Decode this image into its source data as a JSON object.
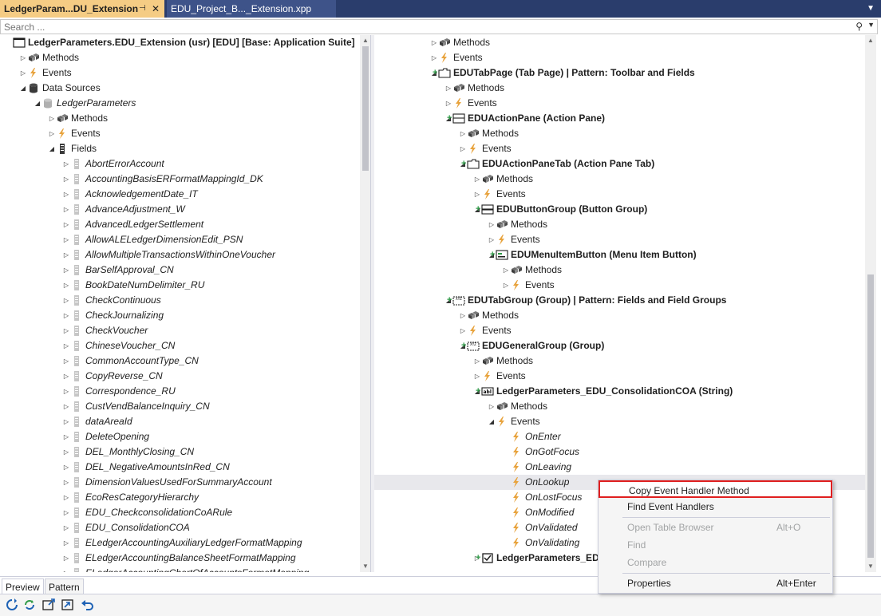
{
  "tabs": [
    {
      "label": "LedgerParam...DU_Extension",
      "pin": "⊣",
      "close": "✕"
    },
    {
      "label": "EDU_Project_B..._Extension.xpp"
    }
  ],
  "search": {
    "placeholder": "Search ..."
  },
  "left_tree": [
    {
      "label": "LedgerParameters.EDU_Extension (usr) [EDU] [Base: Application Suite]",
      "icon": "form-icon",
      "depth": 0,
      "expander": "none",
      "bold": true
    },
    {
      "label": "Methods",
      "icon": "methods-icon",
      "depth": 1,
      "expander": "closed"
    },
    {
      "label": "Events",
      "icon": "events-icon",
      "depth": 1,
      "expander": "closed"
    },
    {
      "label": "Data Sources",
      "icon": "datasources-icon",
      "depth": 1,
      "expander": "open"
    },
    {
      "label": "LedgerParameters",
      "icon": "datasource-icon",
      "depth": 2,
      "expander": "open",
      "italic": true
    },
    {
      "label": "Methods",
      "icon": "methods-icon",
      "depth": 3,
      "expander": "closed"
    },
    {
      "label": "Events",
      "icon": "events-icon",
      "depth": 3,
      "expander": "closed"
    },
    {
      "label": "Fields",
      "icon": "fields-icon",
      "depth": 3,
      "expander": "open"
    },
    {
      "label": "AbortErrorAccount",
      "icon": "field-icon",
      "depth": 4,
      "expander": "closed",
      "italic": true
    },
    {
      "label": "AccountingBasisERFormatMappingId_DK",
      "icon": "field-icon",
      "depth": 4,
      "expander": "closed",
      "italic": true
    },
    {
      "label": "AcknowledgementDate_IT",
      "icon": "field-icon",
      "depth": 4,
      "expander": "closed",
      "italic": true
    },
    {
      "label": "AdvanceAdjustment_W",
      "icon": "field-icon",
      "depth": 4,
      "expander": "closed",
      "italic": true
    },
    {
      "label": "AdvancedLedgerSettlement",
      "icon": "field-icon",
      "depth": 4,
      "expander": "closed",
      "italic": true
    },
    {
      "label": "AllowALELedgerDimensionEdit_PSN",
      "icon": "field-icon",
      "depth": 4,
      "expander": "closed",
      "italic": true
    },
    {
      "label": "AllowMultipleTransactionsWithinOneVoucher",
      "icon": "field-icon",
      "depth": 4,
      "expander": "closed",
      "italic": true
    },
    {
      "label": "BarSelfApproval_CN",
      "icon": "field-icon",
      "depth": 4,
      "expander": "closed",
      "italic": true
    },
    {
      "label": "BookDateNumDelimiter_RU",
      "icon": "field-icon",
      "depth": 4,
      "expander": "closed",
      "italic": true
    },
    {
      "label": "CheckContinuous",
      "icon": "field-icon",
      "depth": 4,
      "expander": "closed",
      "italic": true
    },
    {
      "label": "CheckJournalizing",
      "icon": "field-icon",
      "depth": 4,
      "expander": "closed",
      "italic": true
    },
    {
      "label": "CheckVoucher",
      "icon": "field-icon",
      "depth": 4,
      "expander": "closed",
      "italic": true
    },
    {
      "label": "ChineseVoucher_CN",
      "icon": "field-icon",
      "depth": 4,
      "expander": "closed",
      "italic": true
    },
    {
      "label": "CommonAccountType_CN",
      "icon": "field-icon",
      "depth": 4,
      "expander": "closed",
      "italic": true
    },
    {
      "label": "CopyReverse_CN",
      "icon": "field-icon",
      "depth": 4,
      "expander": "closed",
      "italic": true
    },
    {
      "label": "Correspondence_RU",
      "icon": "field-icon",
      "depth": 4,
      "expander": "closed",
      "italic": true
    },
    {
      "label": "CustVendBalanceInquiry_CN",
      "icon": "field-icon",
      "depth": 4,
      "expander": "closed",
      "italic": true
    },
    {
      "label": "dataAreaId",
      "icon": "field-icon",
      "depth": 4,
      "expander": "closed",
      "italic": true
    },
    {
      "label": "DeleteOpening",
      "icon": "field-icon",
      "depth": 4,
      "expander": "closed",
      "italic": true
    },
    {
      "label": "DEL_MonthlyClosing_CN",
      "icon": "field-icon",
      "depth": 4,
      "expander": "closed",
      "italic": true
    },
    {
      "label": "DEL_NegativeAmountsInRed_CN",
      "icon": "field-icon",
      "depth": 4,
      "expander": "closed",
      "italic": true
    },
    {
      "label": "DimensionValuesUsedForSummaryAccount",
      "icon": "field-icon",
      "depth": 4,
      "expander": "closed",
      "italic": true
    },
    {
      "label": "EcoResCategoryHierarchy",
      "icon": "field-icon",
      "depth": 4,
      "expander": "closed",
      "italic": true
    },
    {
      "label": "EDU_CheckconsolidationCoARule",
      "icon": "field-icon",
      "depth": 4,
      "expander": "closed",
      "italic": true
    },
    {
      "label": "EDU_ConsolidationCOA",
      "icon": "field-icon",
      "depth": 4,
      "expander": "closed",
      "italic": true
    },
    {
      "label": "ELedgerAccountingAuxiliaryLedgerFormatMapping",
      "icon": "field-icon",
      "depth": 4,
      "expander": "closed",
      "italic": true
    },
    {
      "label": "ELedgerAccountingBalanceSheetFormatMapping",
      "icon": "field-icon",
      "depth": 4,
      "expander": "closed",
      "italic": true
    },
    {
      "label": "ELedgerAccountingChartOfAccountsFormatMapping",
      "icon": "field-icon",
      "depth": 4,
      "expander": "closed",
      "italic": true
    }
  ],
  "right_tree": [
    {
      "label": "Methods",
      "icon": "methods-icon",
      "depth": 3,
      "expander": "closed"
    },
    {
      "label": "Events",
      "icon": "events-icon",
      "depth": 3,
      "expander": "closed"
    },
    {
      "label": "EDUTabPage (Tab Page) | Pattern: Toolbar and Fields",
      "icon": "tabpage-icon",
      "depth": 3,
      "expander": "open",
      "plus": true,
      "bold": true
    },
    {
      "label": "Methods",
      "icon": "methods-icon",
      "depth": 4,
      "expander": "closed"
    },
    {
      "label": "Events",
      "icon": "events-icon",
      "depth": 4,
      "expander": "closed"
    },
    {
      "label": "EDUActionPane (Action Pane)",
      "icon": "actionpane-icon",
      "depth": 4,
      "expander": "open",
      "plus": true,
      "bold": true
    },
    {
      "label": "Methods",
      "icon": "methods-icon",
      "depth": 5,
      "expander": "closed"
    },
    {
      "label": "Events",
      "icon": "events-icon",
      "depth": 5,
      "expander": "closed"
    },
    {
      "label": "EDUActionPaneTab (Action Pane Tab)",
      "icon": "tabpage-icon",
      "depth": 5,
      "expander": "open",
      "plus": true,
      "bold": true
    },
    {
      "label": "Methods",
      "icon": "methods-icon",
      "depth": 6,
      "expander": "closed"
    },
    {
      "label": "Events",
      "icon": "events-icon",
      "depth": 6,
      "expander": "closed"
    },
    {
      "label": "EDUButtonGroup (Button Group)",
      "icon": "buttongroup-icon",
      "depth": 6,
      "expander": "open",
      "plus": true,
      "bold": true
    },
    {
      "label": "Methods",
      "icon": "methods-icon",
      "depth": 7,
      "expander": "closed"
    },
    {
      "label": "Events",
      "icon": "events-icon",
      "depth": 7,
      "expander": "closed"
    },
    {
      "label": "EDUMenuItemButton (Menu Item Button)",
      "icon": "menuitembutton-icon",
      "depth": 7,
      "expander": "open",
      "plus": true,
      "bold": true
    },
    {
      "label": "Methods",
      "icon": "methods-icon",
      "depth": 8,
      "expander": "closed"
    },
    {
      "label": "Events",
      "icon": "events-icon",
      "depth": 8,
      "expander": "closed"
    },
    {
      "label": "EDUTabGroup (Group) | Pattern: Fields and Field Groups",
      "icon": "group-icon",
      "depth": 4,
      "expander": "open",
      "plus": true,
      "bold": true
    },
    {
      "label": "Methods",
      "icon": "methods-icon",
      "depth": 5,
      "expander": "closed"
    },
    {
      "label": "Events",
      "icon": "events-icon",
      "depth": 5,
      "expander": "closed"
    },
    {
      "label": "EDUGeneralGroup (Group)",
      "icon": "group-icon",
      "depth": 5,
      "expander": "open",
      "plus": true,
      "bold": true
    },
    {
      "label": "Methods",
      "icon": "methods-icon",
      "depth": 6,
      "expander": "closed"
    },
    {
      "label": "Events",
      "icon": "events-icon",
      "depth": 6,
      "expander": "closed"
    },
    {
      "label": "LedgerParameters_EDU_ConsolidationCOA (String)",
      "icon": "string-icon",
      "depth": 6,
      "expander": "open",
      "plus": true,
      "bold": true
    },
    {
      "label": "Methods",
      "icon": "methods-icon",
      "depth": 7,
      "expander": "closed"
    },
    {
      "label": "Events",
      "icon": "events-icon",
      "depth": 7,
      "expander": "open"
    },
    {
      "label": "OnEnter",
      "icon": "event-icon",
      "depth": 8,
      "expander": "none",
      "italic": true
    },
    {
      "label": "OnGotFocus",
      "icon": "event-icon",
      "depth": 8,
      "expander": "none",
      "italic": true
    },
    {
      "label": "OnLeaving",
      "icon": "event-icon",
      "depth": 8,
      "expander": "none",
      "italic": true
    },
    {
      "label": "OnLookup",
      "icon": "event-icon",
      "depth": 8,
      "expander": "none",
      "italic": true,
      "highlight": true
    },
    {
      "label": "OnLostFocus",
      "icon": "event-icon",
      "depth": 8,
      "expander": "none",
      "italic": true
    },
    {
      "label": "OnModified",
      "icon": "event-icon",
      "depth": 8,
      "expander": "none",
      "italic": true
    },
    {
      "label": "OnValidated",
      "icon": "event-icon",
      "depth": 8,
      "expander": "none",
      "italic": true
    },
    {
      "label": "OnValidating",
      "icon": "event-icon",
      "depth": 8,
      "expander": "none",
      "italic": true
    },
    {
      "label": "LedgerParameters_ED",
      "icon": "checkbox-icon",
      "depth": 6,
      "expander": "closed",
      "plus": true,
      "bold": true
    }
  ],
  "context_menu": [
    {
      "label": "Copy Event Handler Method",
      "shortcut": "",
      "enabled": true,
      "selected": true
    },
    {
      "label": "Find Event Handlers",
      "shortcut": "",
      "enabled": true
    },
    {
      "separator": true
    },
    {
      "label": "Open Table Browser",
      "shortcut": "Alt+O",
      "enabled": false
    },
    {
      "label": "Find",
      "shortcut": "",
      "enabled": false
    },
    {
      "label": "Compare",
      "shortcut": "",
      "enabled": false
    },
    {
      "separator": true
    },
    {
      "label": "Properties",
      "shortcut": "Alt+Enter",
      "enabled": true
    }
  ],
  "bottom_tabs": [
    {
      "label": "Preview",
      "active": true
    },
    {
      "label": "Pattern",
      "active": false
    }
  ],
  "toolbar_buttons": [
    "refresh-icon",
    "sync-icon",
    "open-designer-icon",
    "export-icon",
    "undo-icon"
  ],
  "colors": {
    "tab_active": "#f5cc84",
    "tabbar": "#2a3d6c",
    "highlight_border": "#e01f1f",
    "event_icon": "#e8a33d",
    "plus": "#2f9b47"
  }
}
